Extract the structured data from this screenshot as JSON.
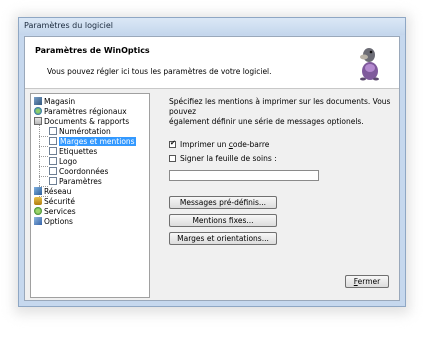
{
  "window": {
    "title": "Paramètres du logiciel"
  },
  "header": {
    "title": "Paramètres de WinOptics",
    "subtitle": "Vous pouvez régler ici tous les paramètres de votre logiciel."
  },
  "tree": {
    "items": [
      {
        "label": "Magasin",
        "icon": "shop-icon"
      },
      {
        "label": "Paramètres régionaux",
        "icon": "globe-icon"
      },
      {
        "label": "Documents & rapports",
        "icon": "documents-icon"
      },
      {
        "label": "Numérotation",
        "icon": "page-icon"
      },
      {
        "label": "Marges et mentions",
        "icon": "page-icon",
        "selected": true
      },
      {
        "label": "Etiquettes",
        "icon": "page-icon"
      },
      {
        "label": "Logo",
        "icon": "page-icon"
      },
      {
        "label": "Coordonnées",
        "icon": "page-icon"
      },
      {
        "label": "Paramètres",
        "icon": "page-icon"
      },
      {
        "label": "Réseau",
        "icon": "network-icon"
      },
      {
        "label": "Sécurité",
        "icon": "lock-icon"
      },
      {
        "label": "Services",
        "icon": "services-icon"
      },
      {
        "label": "Options",
        "icon": "options-icon"
      }
    ]
  },
  "panel": {
    "description_line1": "Spécifiez les mentions à imprimer sur les documents. Vous pouvez",
    "description_line2": "également définir une série de messages optionels.",
    "barcode_checkbox": {
      "label_pre": "Imprimer un ",
      "label_u": "c",
      "label_post": "ode-barre",
      "checked": true
    },
    "signature_checkbox": {
      "label": "Signer la feuille de soins :",
      "checked": false
    },
    "signature_value": "",
    "btn_messages": "Messages pré-définis...",
    "btn_fixed": "Mentions fixes...",
    "btn_margins": "Marges et orientations..."
  },
  "footer": {
    "close_u": "F",
    "close_rest": "ermer"
  }
}
